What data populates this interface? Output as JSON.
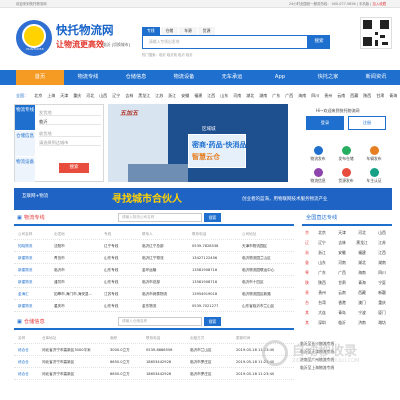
{
  "topbar": {
    "welcome": "欢迎来到快托物流网",
    "right_prefix": "24小时全国统一服务热线：",
    "phone": "400-077-5656",
    "sep": "|",
    "mobile": "手机版",
    "sep2": "|",
    "favorite": "加入收藏"
  },
  "logo": {
    "text": "KUAITUO56",
    "brand": "快托物流网",
    "slogan": "让物流更高效",
    "city": "临沂 [切换城市]"
  },
  "search": {
    "tabs": [
      "专线",
      "仓储",
      "车源",
      "货源"
    ],
    "placeholder": "请输入专线出发地",
    "button": "搜索",
    "hot": "热门搜索：临沂 临沂到 临沂 临沂"
  },
  "nav": [
    "首页",
    "物流专线",
    "仓储信息",
    "物流设备",
    "无车承运",
    "App",
    "快托之家",
    "新闻资讯"
  ],
  "cities": {
    "label": "全国：",
    "items": [
      "北京",
      "上海",
      "天津",
      "重庆",
      "河北",
      "山西",
      "辽宁",
      "吉林",
      "黑龙江",
      "江苏",
      "浙江",
      "安徽",
      "福建",
      "江西",
      "山东",
      "河南",
      "湖北",
      "湖南",
      "广东",
      "广西",
      "海南",
      "四川",
      "贵州",
      "云南",
      "西藏",
      "陕西",
      "甘肃",
      "青海",
      "宁夏",
      "新疆",
      "台湾",
      "香港",
      "澳门",
      "大连",
      "青岛",
      "宁波",
      "厦门",
      "深圳"
    ]
  },
  "leftbox": {
    "tab1": "物流专线",
    "tab2": "仓储信息",
    "tab3": "物流设备",
    "from_label": "发货地",
    "from_value": "临沂",
    "to_label": "收货地",
    "to_value": "请选择到达城市",
    "search": "搜索"
  },
  "banner": {
    "brand": "五加五",
    "t1": "区域城",
    "t2": "密商·药品·快消品",
    "t3": "智慧云仓"
  },
  "right": {
    "welcome": "Hi~欢迎来到快托物流网",
    "login": "登录",
    "register": "注册",
    "icons": [
      "物流发布",
      "发布仓储",
      "车辆发布",
      "物流信息",
      "货源发布",
      "车主认证"
    ]
  },
  "ad": {
    "l1": "互联网+物流",
    "l2": "寻找城市合伙人",
    "l3": "创业者的蓝海，用物联网技术服务物流产业"
  },
  "lines": {
    "title": "物流专线",
    "search_placeholder": "请输入物流公司名称",
    "search_button": "搜索",
    "header": [
      "公司名称",
      "出发地",
      "专线",
      "联系人",
      "联系电话",
      "公司地址"
    ],
    "rows": [
      [
        "知晓物流",
        "沈阳市",
        "辽宁专线",
        "临沂辽宁总部",
        "0539-7828538",
        "天津市物流园区"
      ],
      [
        "新建物流",
        "青岛市",
        "山东专线",
        "临沂辽宁物流",
        "13427122456",
        "临沂物流园兰山区"
      ],
      [
        "新建物流",
        "临沂市",
        "山东专线",
        "金环运输",
        "13581908716",
        "临沂物流园联运中心"
      ],
      [
        "新建物流",
        "潍坊市",
        "山东专线",
        "临沂市总部",
        "13581908716",
        "临沂市十四区"
      ],
      [
        "金海汇",
        "如皋市,海门市,海安县...",
        "江苏专线",
        "临沂市润泰物流",
        "13954919018",
        "临沂物流园区新路"
      ],
      [
        "新建物流",
        "重庆市",
        "山东专线",
        "金东物流",
        "0539-7021277",
        "山东省临沂市兰山区"
      ]
    ]
  },
  "storage": {
    "title": "仓储信息",
    "search_placeholder": "请输入仓储名称",
    "search_button": "搜索",
    "header": [
      "名称",
      "仓库地址",
      "面积",
      "联系电话",
      "出租方式",
      "更新时间"
    ],
    "rows": [
      [
        "综合仓",
        "河北省济宁市高新区3000平米",
        "3000.0立方",
        "0539-8686556",
        "临沂市兰山区",
        "2019-05-18 11:23:40"
      ],
      [
        "综合仓",
        "河北省济宁市高新区",
        "6650.0立方",
        "18653442926",
        "临沂市罗庄区",
        "2019-05-18 11:23:40"
      ],
      [
        "综合仓",
        "河北省济宁市高新区",
        "6650.0立方",
        "18653442926",
        "临沂市罗庄区",
        "2019-05-18 11:23:40"
      ]
    ]
  },
  "rightpanel": {
    "title": "全国直达专线",
    "grid": [
      [
        "京",
        "北京",
        "天津",
        "河北",
        "山西"
      ],
      [
        "辽",
        "辽宁",
        "吉林",
        "黑龙江",
        "江苏"
      ],
      [
        "浙",
        "浙江",
        "安徽",
        "福建",
        "江西"
      ],
      [
        "鲁",
        "山东",
        "河南",
        "湖北",
        "湖南"
      ],
      [
        "粤",
        "广东",
        "广西",
        "海南",
        "四川"
      ],
      [
        "陕",
        "陕西",
        "甘肃",
        "青海",
        "宁夏"
      ],
      [
        "贵",
        "贵州",
        "云南",
        "西藏",
        "新疆"
      ],
      [
        "台",
        "台湾",
        "香港",
        "澳门",
        "重庆"
      ],
      [
        "其",
        "大连",
        "青岛",
        "宁波",
        "厦门"
      ],
      [
        "其",
        "深圳",
        "临沂",
        "济南",
        "潍坊"
      ]
    ]
  },
  "side": {
    "items": [
      "临沂至长沙物流专线",
      "临沂至天津物流专线",
      "济南至广州物流专线",
      "临沂至上海物流专线"
    ]
  },
  "watermark": {
    "title": "自动秒收录",
    "sub": "ZIDONGMIAOSHOULU.COM"
  }
}
